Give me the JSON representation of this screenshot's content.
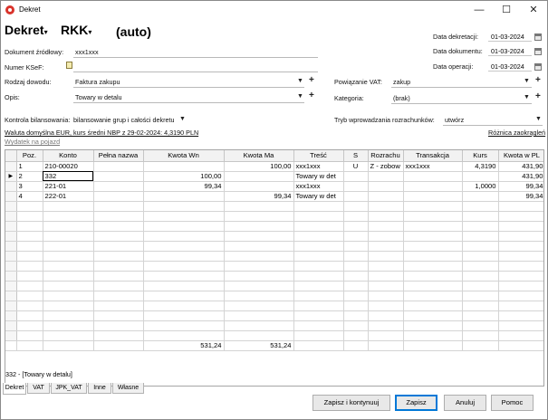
{
  "window": {
    "title": "Dekret",
    "minimize": "—",
    "maximize": "☐",
    "close": "✕"
  },
  "header": {
    "type": "Dekret",
    "code": "RKK",
    "auto": "(auto)"
  },
  "dates": [
    {
      "label": "Data dekretacji:",
      "value": "01-03-2024"
    },
    {
      "label": "Data dokumentu:",
      "value": "01-03-2024"
    },
    {
      "label": "Data operacji:",
      "value": "01-03-2024"
    }
  ],
  "fields": {
    "dokument_zrodlowy": {
      "label": "Dokument źródłowy:",
      "value": "xxx1xxx"
    },
    "numer_ksef": {
      "label": "Numer KSeF:",
      "value": ""
    },
    "rodzaj_dowodu": {
      "label": "Rodzaj dowodu:",
      "value": "Faktura zakupu"
    },
    "opis": {
      "label": "Opis:",
      "value": "Towary w detalu"
    },
    "powiazanie_vat": {
      "label": "Powiązanie VAT:",
      "value": "zakup"
    },
    "kategoria": {
      "label": "Kategoria:",
      "value": "(brak)"
    },
    "kontrola": {
      "label": "Kontrola bilansowania:",
      "value": "bilansowanie grup i całości dekretu"
    },
    "tryb": {
      "label": "Tryb wprowadzania rozrachunków:",
      "value": "utwórz"
    }
  },
  "links": {
    "waluta": "Waluta domyślna EUR, kurs średni NBP z 29-02-2024: 4,3190 PLN",
    "wydatek": "Wydatek na pojazd",
    "roznica": "Różnica zaokrągleń"
  },
  "grid": {
    "columns": [
      "Poz.",
      "Konto",
      "Pełna nazwa",
      "Kwota Wn",
      "Kwota Ma",
      "Treść",
      "S",
      "Rozrachu",
      "Transakcja",
      "Kurs",
      "Kwota w PL"
    ],
    "rows": [
      {
        "poz": "1",
        "konto": "210-00020",
        "nazwa": "",
        "wn": "",
        "ma": "100,00",
        "tresc": "xxx1xxx",
        "s": "U",
        "rozrachu": "Z - zobow",
        "transakcja": "xxx1xxx",
        "kurs": "4,3190",
        "pln": "431,90"
      },
      {
        "poz": "2",
        "konto": "332",
        "nazwa": "",
        "wn": "100,00",
        "ma": "",
        "tresc": "Towary w det",
        "s": "",
        "rozrachu": "",
        "transakcja": "",
        "kurs": "",
        "pln": "431,90"
      },
      {
        "poz": "3",
        "konto": "221-01",
        "nazwa": "",
        "wn": "99,34",
        "ma": "",
        "tresc": "xxx1xxx",
        "s": "",
        "rozrachu": "",
        "transakcja": "",
        "kurs": "1,0000",
        "pln": "99,34"
      },
      {
        "poz": "4",
        "konto": "222-01",
        "nazwa": "",
        "wn": "",
        "ma": "99,34",
        "tresc": "Towary w det",
        "s": "",
        "rozrachu": "",
        "transakcja": "",
        "kurs": "",
        "pln": "99,34"
      }
    ],
    "totals": {
      "wn": "531,24",
      "ma": "531,24"
    }
  },
  "status_text": "332 - [Towary w detalu]",
  "tabs": [
    "Dekret",
    "VAT",
    "JPK_VAT",
    "Inne",
    "Własne"
  ],
  "buttons": {
    "save_continue": "Zapisz i kontynuuj",
    "save": "Zapisz",
    "cancel": "Anuluj",
    "help": "Pomoc"
  }
}
